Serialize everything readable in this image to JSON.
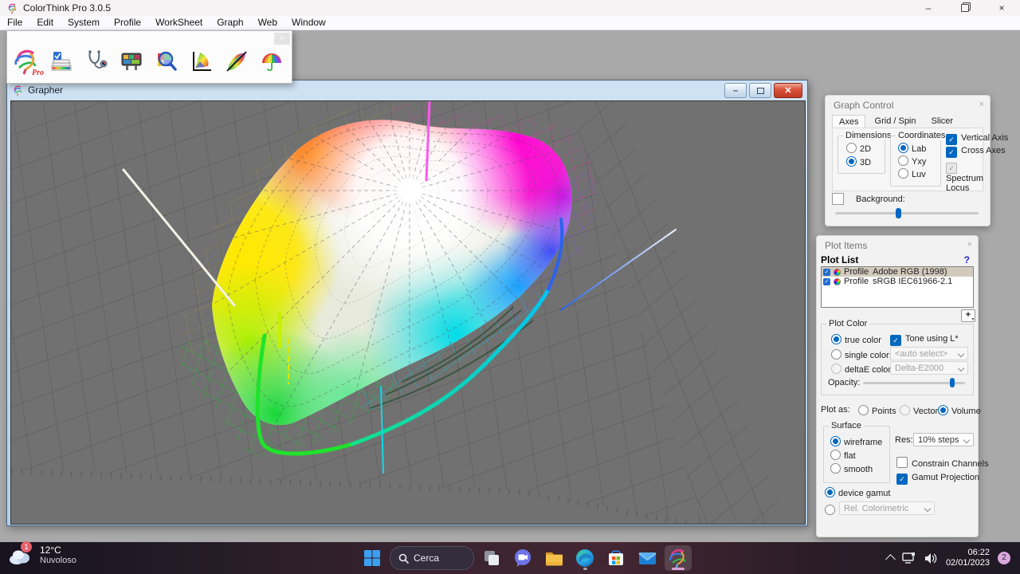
{
  "window": {
    "title": "ColorThink Pro 3.0.5"
  },
  "menu": {
    "items": [
      "File",
      "Edit",
      "System",
      "Profile",
      "WorkSheet",
      "Graph",
      "Web",
      "Window"
    ]
  },
  "toolbar": {
    "pro_label": "Pro",
    "icons": [
      "colorthink-brain",
      "profile-stack",
      "profile-doctor",
      "image-viewer",
      "color-inspector",
      "chromaticity-2d",
      "grapher-3d",
      "spectral-palette"
    ]
  },
  "grapher": {
    "title": "Grapher"
  },
  "graph_control": {
    "title": "Graph Control",
    "tabs": [
      "Axes",
      "Grid / Spin",
      "Slicer"
    ],
    "active_tab": "Axes",
    "dimensions": {
      "label": "Dimensions",
      "d2": "2D",
      "d3": "3D",
      "selected": "3D"
    },
    "coordinates": {
      "label": "Coordinates",
      "lab": "Lab",
      "yxy": "Yxy",
      "luv": "Luv",
      "selected": "Lab"
    },
    "vertical_axis": "Vertical Axis",
    "cross_axes": "Cross Axes",
    "spectrum_locus": "Spectrum Locus",
    "background_label": "Background:",
    "background_slider_pct": 42
  },
  "plot_items": {
    "title": "Plot Items",
    "list_label": "Plot List",
    "help": "?",
    "add": "+",
    "rows": [
      {
        "type": "Profile",
        "name": "Adobe RGB (1998)",
        "checked": true,
        "selected": true
      },
      {
        "type": "Profile",
        "name": "sRGB IEC61966-2.1",
        "checked": true,
        "selected": false
      }
    ],
    "plot_color": {
      "label": "Plot Color",
      "true_color": "true color",
      "tone": "Tone using L*",
      "single_color": "single color:",
      "single_value": "<auto select>",
      "deltae": "deltaE color:",
      "deltae_value": "Delta-E2000",
      "opacity": "Opacity:",
      "opacity_pct": 85
    },
    "plot_as": {
      "label": "Plot as:",
      "points": "Points",
      "vectors": "Vectors",
      "volume": "Volume",
      "selected": "Volume"
    },
    "surface": {
      "label": "Surface",
      "wireframe": "wireframe",
      "flat": "flat",
      "smooth": "smooth",
      "selected": "wireframe"
    },
    "res": {
      "label": "Res:",
      "value": "10% steps"
    },
    "constrain": "Constrain Channels",
    "gamut_projection": "Gamut Projection",
    "device_gamut": "device gamut",
    "rendering_intent": "Rel. Colorimetric"
  },
  "taskbar": {
    "weather": {
      "badge": "1",
      "temp": "12°C",
      "condition": "Nuvoloso"
    },
    "search": "Cerca",
    "icons": [
      "start",
      "search",
      "task-view",
      "chat",
      "file-explorer",
      "edge",
      "store",
      "mail",
      "colorthink"
    ],
    "tray": {
      "time": "06:22",
      "date": "02/01/2023",
      "badge": "2"
    }
  },
  "colors": {
    "accent": "#0067c0",
    "list_selection": "#d2cbbd",
    "canvas_bg": "#717171",
    "close_red": "#c03a26"
  }
}
